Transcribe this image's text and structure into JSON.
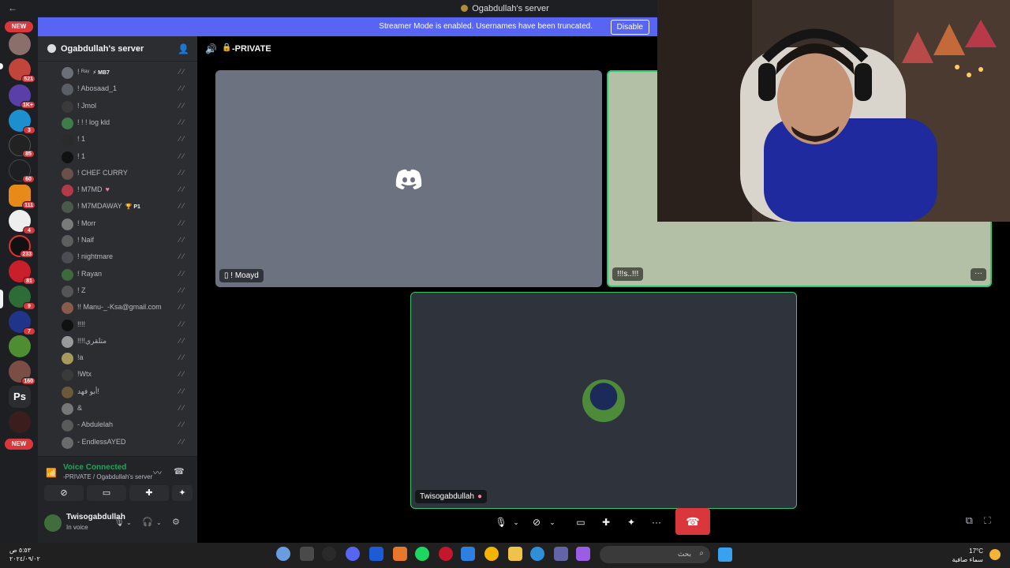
{
  "window": {
    "title": "Ogabdullah's server",
    "back_glyph": "←"
  },
  "streamer_banner": {
    "message": "Streamer Mode is enabled. Usernames have been truncated.",
    "button": "Disable"
  },
  "server_rail": {
    "new_top": "NEW",
    "new_bottom": "NEW",
    "ps_label": "Ps",
    "badges": [
      "521",
      "1K+",
      "3",
      "85",
      "60",
      "111",
      "4",
      "233",
      "81",
      "9",
      "7",
      "160"
    ]
  },
  "server": {
    "name": "Ogabdullah's server",
    "chevron": "⌄",
    "invite_icon": "person-add-icon"
  },
  "members": [
    {
      "name": "! ᴿᵃᵞ",
      "tag": "⚡ MB7"
    },
    {
      "name": "! Abosaad_1"
    },
    {
      "name": "! Jmol"
    },
    {
      "name": "! ! ! log kld"
    },
    {
      "name": "! 1"
    },
    {
      "name": "! 1"
    },
    {
      "name": "! CHEF CURRY"
    },
    {
      "name": "! M7MD",
      "heart": "♥"
    },
    {
      "name": "! M7MDAWAY",
      "tag": "🏆 P1"
    },
    {
      "name": "! Morr"
    },
    {
      "name": "! Naif"
    },
    {
      "name": "! nightmare"
    },
    {
      "name": "! Rayan"
    },
    {
      "name": "! Z"
    },
    {
      "name": "!! Manu-_-Ksa@gmail.com"
    },
    {
      "name": "!!!!"
    },
    {
      "name": "!!!!متلقري"
    },
    {
      "name": "!a"
    },
    {
      "name": "!Wtx"
    },
    {
      "name": "أبو فهد!"
    },
    {
      "name": "&"
    },
    {
      "name": "- Abdulelah"
    },
    {
      "name": "- EndlessAYED"
    }
  ],
  "voice": {
    "status": "Voice Connected",
    "location": "-PRIVATE / Ogabdullah's server",
    "buttons": [
      "camera-off-icon",
      "screen-share-icon",
      "activities-icon",
      "soundboard-icon"
    ]
  },
  "user": {
    "name": "Twisogabdullah",
    "status": "In voice"
  },
  "channel": {
    "name": "-PRIVATE"
  },
  "tiles": [
    {
      "label": "! Moayd"
    },
    {
      "label": "!!!s..!!!",
      "more": "···"
    },
    {
      "label": "Twisogabdullah"
    }
  ],
  "call_controls": [
    "mic-icon",
    "camera-off-icon",
    "screen-share-icon",
    "activities-icon",
    "soundboard-icon",
    "more-icon",
    "hang-up-icon"
  ],
  "taskbar": {
    "time": "٥:٥٣ ص",
    "date": "٢٠٢٤/٠٩/٠٢",
    "search_placeholder": "بحث",
    "temperature": "17°C",
    "weather": "سماء صافية"
  },
  "colors": {
    "brand": "#5865f2",
    "danger": "#da373c",
    "online": "#23a55a",
    "speaking": "#2dc770"
  }
}
